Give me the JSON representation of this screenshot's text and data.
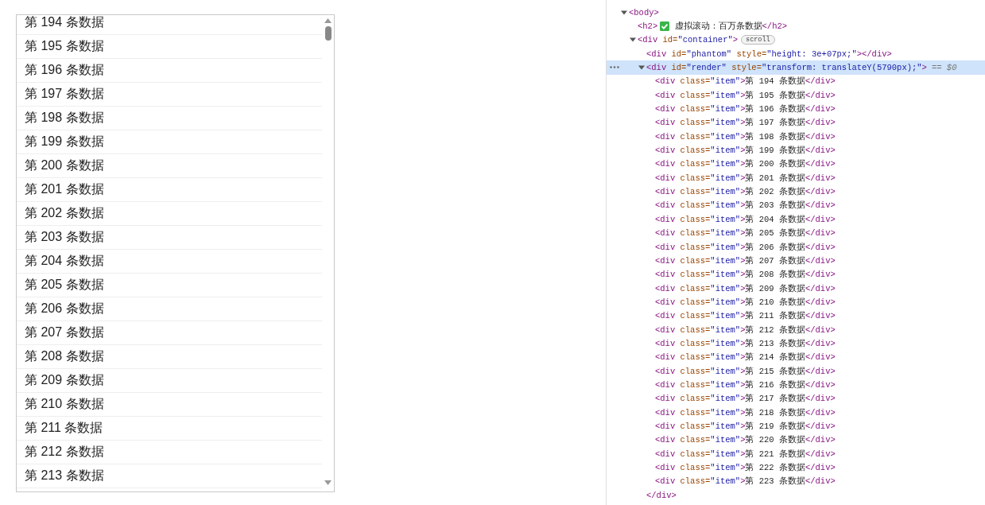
{
  "list": {
    "items": [
      "第 194 条数据",
      "第 195 条数据",
      "第 196 条数据",
      "第 197 条数据",
      "第 198 条数据",
      "第 199 条数据",
      "第 200 条数据",
      "第 201 条数据",
      "第 202 条数据",
      "第 203 条数据",
      "第 204 条数据",
      "第 205 条数据",
      "第 206 条数据",
      "第 207 条数据",
      "第 208 条数据",
      "第 209 条数据",
      "第 210 条数据",
      "第 211 条数据",
      "第 212 条数据",
      "第 213 条数据"
    ]
  },
  "devtools": {
    "nodes": [
      {
        "selected": false,
        "expanded": true,
        "open": [
          {
            "kind": "code",
            "tokens": [
              {
                "tag": "<body>"
              }
            ]
          }
        ],
        "children": [
          {
            "selected": false,
            "open": [
              {
                "kind": "code",
                "tokens": [
                  {
                    "tag": "<h2>"
                  }
                ]
              },
              {
                "kind": "icon"
              },
              {
                "kind": "code",
                "tokens": [
                  {
                    "text": " 虚拟滚动：百万条数据"
                  },
                  {
                    "tag": "</h2>"
                  }
                ]
              }
            ]
          },
          {
            "selected": false,
            "expanded": true,
            "open": [
              {
                "kind": "code",
                "tokens": [
                  {
                    "tag": "<div"
                  },
                  {
                    "attr": " id="
                  },
                  {
                    "value": "\"container\""
                  },
                  {
                    "tag": ">"
                  }
                ]
              },
              {
                "kind": "badge",
                "text": "scroll"
              }
            ],
            "children": [
              {
                "selected": false,
                "open": [
                  {
                    "kind": "code",
                    "tokens": [
                      {
                        "tag": "<div"
                      },
                      {
                        "attr": " id="
                      },
                      {
                        "value": "\"phantom\""
                      },
                      {
                        "attr": " style="
                      },
                      {
                        "value": "\"height: 3e+07px;\""
                      },
                      {
                        "tag": "></div>"
                      }
                    ]
                  }
                ]
              },
              {
                "selected": true,
                "expanded": true,
                "open": [
                  {
                    "kind": "code",
                    "tokens": [
                      {
                        "tag": "<div"
                      },
                      {
                        "attr": " id="
                      },
                      {
                        "value": "\"render\""
                      },
                      {
                        "attr": " style="
                      },
                      {
                        "value": "\"transform: translateY(5790px);\""
                      },
                      {
                        "tag": ">"
                      }
                    ]
                  },
                  {
                    "kind": "ref",
                    "text": "== $0"
                  }
                ],
                "close": [
                  {
                    "kind": "code",
                    "tokens": [
                      {
                        "tag": "</div>"
                      }
                    ]
                  }
                ],
                "children": [
                  {
                    "selected": false,
                    "open": [
                      {
                        "kind": "code",
                        "tokens": [
                          {
                            "tag": "<div"
                          },
                          {
                            "attr": " class="
                          },
                          {
                            "value": "\"item\""
                          },
                          {
                            "tag": ">"
                          },
                          {
                            "text": "第 194 条数据"
                          },
                          {
                            "tag": "</div>"
                          }
                        ]
                      }
                    ]
                  },
                  {
                    "selected": false,
                    "open": [
                      {
                        "kind": "code",
                        "tokens": [
                          {
                            "tag": "<div"
                          },
                          {
                            "attr": " class="
                          },
                          {
                            "value": "\"item\""
                          },
                          {
                            "tag": ">"
                          },
                          {
                            "text": "第 195 条数据"
                          },
                          {
                            "tag": "</div>"
                          }
                        ]
                      }
                    ]
                  },
                  {
                    "selected": false,
                    "open": [
                      {
                        "kind": "code",
                        "tokens": [
                          {
                            "tag": "<div"
                          },
                          {
                            "attr": " class="
                          },
                          {
                            "value": "\"item\""
                          },
                          {
                            "tag": ">"
                          },
                          {
                            "text": "第 196 条数据"
                          },
                          {
                            "tag": "</div>"
                          }
                        ]
                      }
                    ]
                  },
                  {
                    "selected": false,
                    "open": [
                      {
                        "kind": "code",
                        "tokens": [
                          {
                            "tag": "<div"
                          },
                          {
                            "attr": " class="
                          },
                          {
                            "value": "\"item\""
                          },
                          {
                            "tag": ">"
                          },
                          {
                            "text": "第 197 条数据"
                          },
                          {
                            "tag": "</div>"
                          }
                        ]
                      }
                    ]
                  },
                  {
                    "selected": false,
                    "open": [
                      {
                        "kind": "code",
                        "tokens": [
                          {
                            "tag": "<div"
                          },
                          {
                            "attr": " class="
                          },
                          {
                            "value": "\"item\""
                          },
                          {
                            "tag": ">"
                          },
                          {
                            "text": "第 198 条数据"
                          },
                          {
                            "tag": "</div>"
                          }
                        ]
                      }
                    ]
                  },
                  {
                    "selected": false,
                    "open": [
                      {
                        "kind": "code",
                        "tokens": [
                          {
                            "tag": "<div"
                          },
                          {
                            "attr": " class="
                          },
                          {
                            "value": "\"item\""
                          },
                          {
                            "tag": ">"
                          },
                          {
                            "text": "第 199 条数据"
                          },
                          {
                            "tag": "</div>"
                          }
                        ]
                      }
                    ]
                  },
                  {
                    "selected": false,
                    "open": [
                      {
                        "kind": "code",
                        "tokens": [
                          {
                            "tag": "<div"
                          },
                          {
                            "attr": " class="
                          },
                          {
                            "value": "\"item\""
                          },
                          {
                            "tag": ">"
                          },
                          {
                            "text": "第 200 条数据"
                          },
                          {
                            "tag": "</div>"
                          }
                        ]
                      }
                    ]
                  },
                  {
                    "selected": false,
                    "open": [
                      {
                        "kind": "code",
                        "tokens": [
                          {
                            "tag": "<div"
                          },
                          {
                            "attr": " class="
                          },
                          {
                            "value": "\"item\""
                          },
                          {
                            "tag": ">"
                          },
                          {
                            "text": "第 201 条数据"
                          },
                          {
                            "tag": "</div>"
                          }
                        ]
                      }
                    ]
                  },
                  {
                    "selected": false,
                    "open": [
                      {
                        "kind": "code",
                        "tokens": [
                          {
                            "tag": "<div"
                          },
                          {
                            "attr": " class="
                          },
                          {
                            "value": "\"item\""
                          },
                          {
                            "tag": ">"
                          },
                          {
                            "text": "第 202 条数据"
                          },
                          {
                            "tag": "</div>"
                          }
                        ]
                      }
                    ]
                  },
                  {
                    "selected": false,
                    "open": [
                      {
                        "kind": "code",
                        "tokens": [
                          {
                            "tag": "<div"
                          },
                          {
                            "attr": " class="
                          },
                          {
                            "value": "\"item\""
                          },
                          {
                            "tag": ">"
                          },
                          {
                            "text": "第 203 条数据"
                          },
                          {
                            "tag": "</div>"
                          }
                        ]
                      }
                    ]
                  },
                  {
                    "selected": false,
                    "open": [
                      {
                        "kind": "code",
                        "tokens": [
                          {
                            "tag": "<div"
                          },
                          {
                            "attr": " class="
                          },
                          {
                            "value": "\"item\""
                          },
                          {
                            "tag": ">"
                          },
                          {
                            "text": "第 204 条数据"
                          },
                          {
                            "tag": "</div>"
                          }
                        ]
                      }
                    ]
                  },
                  {
                    "selected": false,
                    "open": [
                      {
                        "kind": "code",
                        "tokens": [
                          {
                            "tag": "<div"
                          },
                          {
                            "attr": " class="
                          },
                          {
                            "value": "\"item\""
                          },
                          {
                            "tag": ">"
                          },
                          {
                            "text": "第 205 条数据"
                          },
                          {
                            "tag": "</div>"
                          }
                        ]
                      }
                    ]
                  },
                  {
                    "selected": false,
                    "open": [
                      {
                        "kind": "code",
                        "tokens": [
                          {
                            "tag": "<div"
                          },
                          {
                            "attr": " class="
                          },
                          {
                            "value": "\"item\""
                          },
                          {
                            "tag": ">"
                          },
                          {
                            "text": "第 206 条数据"
                          },
                          {
                            "tag": "</div>"
                          }
                        ]
                      }
                    ]
                  },
                  {
                    "selected": false,
                    "open": [
                      {
                        "kind": "code",
                        "tokens": [
                          {
                            "tag": "<div"
                          },
                          {
                            "attr": " class="
                          },
                          {
                            "value": "\"item\""
                          },
                          {
                            "tag": ">"
                          },
                          {
                            "text": "第 207 条数据"
                          },
                          {
                            "tag": "</div>"
                          }
                        ]
                      }
                    ]
                  },
                  {
                    "selected": false,
                    "open": [
                      {
                        "kind": "code",
                        "tokens": [
                          {
                            "tag": "<div"
                          },
                          {
                            "attr": " class="
                          },
                          {
                            "value": "\"item\""
                          },
                          {
                            "tag": ">"
                          },
                          {
                            "text": "第 208 条数据"
                          },
                          {
                            "tag": "</div>"
                          }
                        ]
                      }
                    ]
                  },
                  {
                    "selected": false,
                    "open": [
                      {
                        "kind": "code",
                        "tokens": [
                          {
                            "tag": "<div"
                          },
                          {
                            "attr": " class="
                          },
                          {
                            "value": "\"item\""
                          },
                          {
                            "tag": ">"
                          },
                          {
                            "text": "第 209 条数据"
                          },
                          {
                            "tag": "</div>"
                          }
                        ]
                      }
                    ]
                  },
                  {
                    "selected": false,
                    "open": [
                      {
                        "kind": "code",
                        "tokens": [
                          {
                            "tag": "<div"
                          },
                          {
                            "attr": " class="
                          },
                          {
                            "value": "\"item\""
                          },
                          {
                            "tag": ">"
                          },
                          {
                            "text": "第 210 条数据"
                          },
                          {
                            "tag": "</div>"
                          }
                        ]
                      }
                    ]
                  },
                  {
                    "selected": false,
                    "open": [
                      {
                        "kind": "code",
                        "tokens": [
                          {
                            "tag": "<div"
                          },
                          {
                            "attr": " class="
                          },
                          {
                            "value": "\"item\""
                          },
                          {
                            "tag": ">"
                          },
                          {
                            "text": "第 211 条数据"
                          },
                          {
                            "tag": "</div>"
                          }
                        ]
                      }
                    ]
                  },
                  {
                    "selected": false,
                    "open": [
                      {
                        "kind": "code",
                        "tokens": [
                          {
                            "tag": "<div"
                          },
                          {
                            "attr": " class="
                          },
                          {
                            "value": "\"item\""
                          },
                          {
                            "tag": ">"
                          },
                          {
                            "text": "第 212 条数据"
                          },
                          {
                            "tag": "</div>"
                          }
                        ]
                      }
                    ]
                  },
                  {
                    "selected": false,
                    "open": [
                      {
                        "kind": "code",
                        "tokens": [
                          {
                            "tag": "<div"
                          },
                          {
                            "attr": " class="
                          },
                          {
                            "value": "\"item\""
                          },
                          {
                            "tag": ">"
                          },
                          {
                            "text": "第 213 条数据"
                          },
                          {
                            "tag": "</div>"
                          }
                        ]
                      }
                    ]
                  },
                  {
                    "selected": false,
                    "open": [
                      {
                        "kind": "code",
                        "tokens": [
                          {
                            "tag": "<div"
                          },
                          {
                            "attr": " class="
                          },
                          {
                            "value": "\"item\""
                          },
                          {
                            "tag": ">"
                          },
                          {
                            "text": "第 214 条数据"
                          },
                          {
                            "tag": "</div>"
                          }
                        ]
                      }
                    ]
                  },
                  {
                    "selected": false,
                    "open": [
                      {
                        "kind": "code",
                        "tokens": [
                          {
                            "tag": "<div"
                          },
                          {
                            "attr": " class="
                          },
                          {
                            "value": "\"item\""
                          },
                          {
                            "tag": ">"
                          },
                          {
                            "text": "第 215 条数据"
                          },
                          {
                            "tag": "</div>"
                          }
                        ]
                      }
                    ]
                  },
                  {
                    "selected": false,
                    "open": [
                      {
                        "kind": "code",
                        "tokens": [
                          {
                            "tag": "<div"
                          },
                          {
                            "attr": " class="
                          },
                          {
                            "value": "\"item\""
                          },
                          {
                            "tag": ">"
                          },
                          {
                            "text": "第 216 条数据"
                          },
                          {
                            "tag": "</div>"
                          }
                        ]
                      }
                    ]
                  },
                  {
                    "selected": false,
                    "open": [
                      {
                        "kind": "code",
                        "tokens": [
                          {
                            "tag": "<div"
                          },
                          {
                            "attr": " class="
                          },
                          {
                            "value": "\"item\""
                          },
                          {
                            "tag": ">"
                          },
                          {
                            "text": "第 217 条数据"
                          },
                          {
                            "tag": "</div>"
                          }
                        ]
                      }
                    ]
                  },
                  {
                    "selected": false,
                    "open": [
                      {
                        "kind": "code",
                        "tokens": [
                          {
                            "tag": "<div"
                          },
                          {
                            "attr": " class="
                          },
                          {
                            "value": "\"item\""
                          },
                          {
                            "tag": ">"
                          },
                          {
                            "text": "第 218 条数据"
                          },
                          {
                            "tag": "</div>"
                          }
                        ]
                      }
                    ]
                  },
                  {
                    "selected": false,
                    "open": [
                      {
                        "kind": "code",
                        "tokens": [
                          {
                            "tag": "<div"
                          },
                          {
                            "attr": " class="
                          },
                          {
                            "value": "\"item\""
                          },
                          {
                            "tag": ">"
                          },
                          {
                            "text": "第 219 条数据"
                          },
                          {
                            "tag": "</div>"
                          }
                        ]
                      }
                    ]
                  },
                  {
                    "selected": false,
                    "open": [
                      {
                        "kind": "code",
                        "tokens": [
                          {
                            "tag": "<div"
                          },
                          {
                            "attr": " class="
                          },
                          {
                            "value": "\"item\""
                          },
                          {
                            "tag": ">"
                          },
                          {
                            "text": "第 220 条数据"
                          },
                          {
                            "tag": "</div>"
                          }
                        ]
                      }
                    ]
                  },
                  {
                    "selected": false,
                    "open": [
                      {
                        "kind": "code",
                        "tokens": [
                          {
                            "tag": "<div"
                          },
                          {
                            "attr": " class="
                          },
                          {
                            "value": "\"item\""
                          },
                          {
                            "tag": ">"
                          },
                          {
                            "text": "第 221 条数据"
                          },
                          {
                            "tag": "</div>"
                          }
                        ]
                      }
                    ]
                  },
                  {
                    "selected": false,
                    "open": [
                      {
                        "kind": "code",
                        "tokens": [
                          {
                            "tag": "<div"
                          },
                          {
                            "attr": " class="
                          },
                          {
                            "value": "\"item\""
                          },
                          {
                            "tag": ">"
                          },
                          {
                            "text": "第 222 条数据"
                          },
                          {
                            "tag": "</div>"
                          }
                        ]
                      }
                    ]
                  },
                  {
                    "selected": false,
                    "open": [
                      {
                        "kind": "code",
                        "tokens": [
                          {
                            "tag": "<div"
                          },
                          {
                            "attr": " class="
                          },
                          {
                            "value": "\"item\""
                          },
                          {
                            "tag": ">"
                          },
                          {
                            "text": "第 223 条数据"
                          },
                          {
                            "tag": "</div>"
                          }
                        ]
                      }
                    ]
                  }
                ]
              }
            ]
          }
        ]
      }
    ]
  }
}
